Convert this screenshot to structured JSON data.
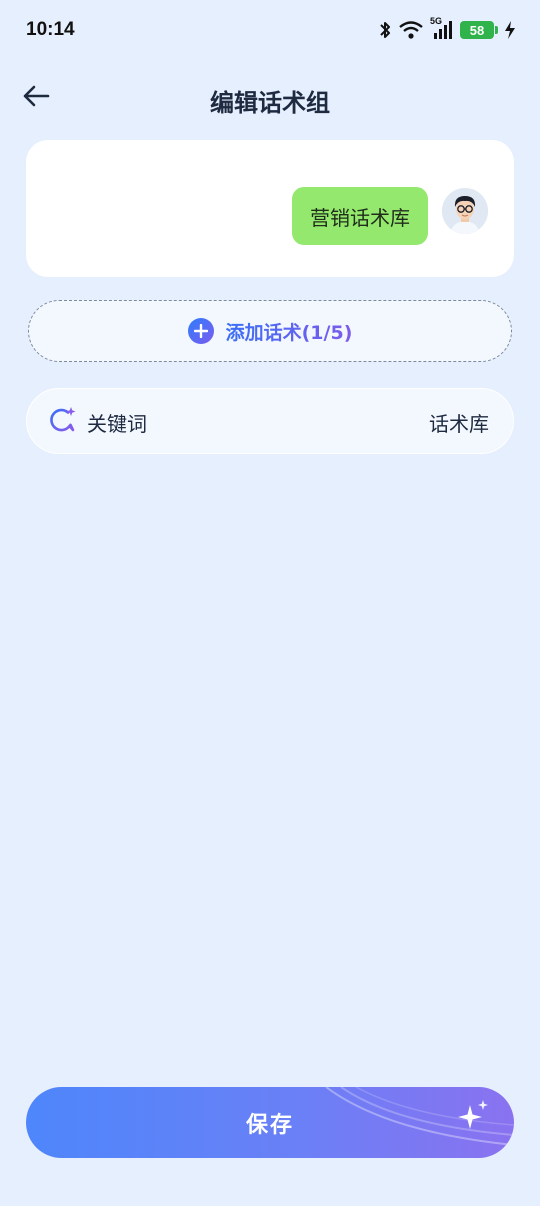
{
  "status_bar": {
    "time": "10:14",
    "network": "5G",
    "battery": "58",
    "icons": [
      "bluetooth-icon",
      "wifi-icon",
      "signal-icon",
      "battery-icon",
      "charging-icon"
    ]
  },
  "header": {
    "title": "编辑话术组",
    "back_icon": "arrow-left-icon"
  },
  "chat": {
    "message": "营销话术库",
    "bubble_color": "#94e86d"
  },
  "add_script": {
    "label": "添加话术(1/5)",
    "icon": "plus-circle-icon"
  },
  "keyword": {
    "label": "关键词",
    "library": "话术库",
    "icon": "chat-sparkle-icon"
  },
  "save": {
    "label": "保存",
    "icon": "sparkle-icon"
  },
  "colors": {
    "background": "#e6effd",
    "accent_blue": "#3a6ff8",
    "accent_purple": "#7d5bea",
    "battery": "#2fb34a"
  }
}
